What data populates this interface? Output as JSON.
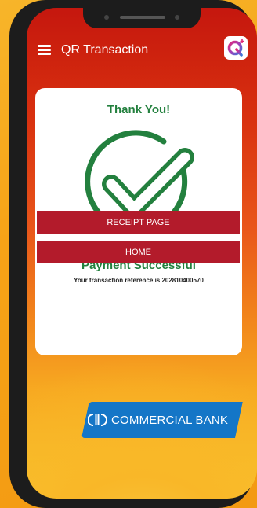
{
  "appbar": {
    "title": "QR Transaction",
    "menu_icon": "hamburger-menu-icon",
    "logo_letter": "Q"
  },
  "card": {
    "thank_you": "Thank You!",
    "status_icon": "check-circle-icon",
    "payment_title": "Payment Successful",
    "reference_text": "Your transaction reference is 202810400570"
  },
  "buttons": {
    "receipt": "RECEIPT PAGE",
    "home": "HOME"
  },
  "bank": {
    "name": "COMMERCIAL BANK",
    "logo_icon": "commercial-bank-logo-icon"
  },
  "colors": {
    "success_green": "#23803e",
    "button_red": "#b31b2b",
    "bank_blue": "#1476c7"
  }
}
